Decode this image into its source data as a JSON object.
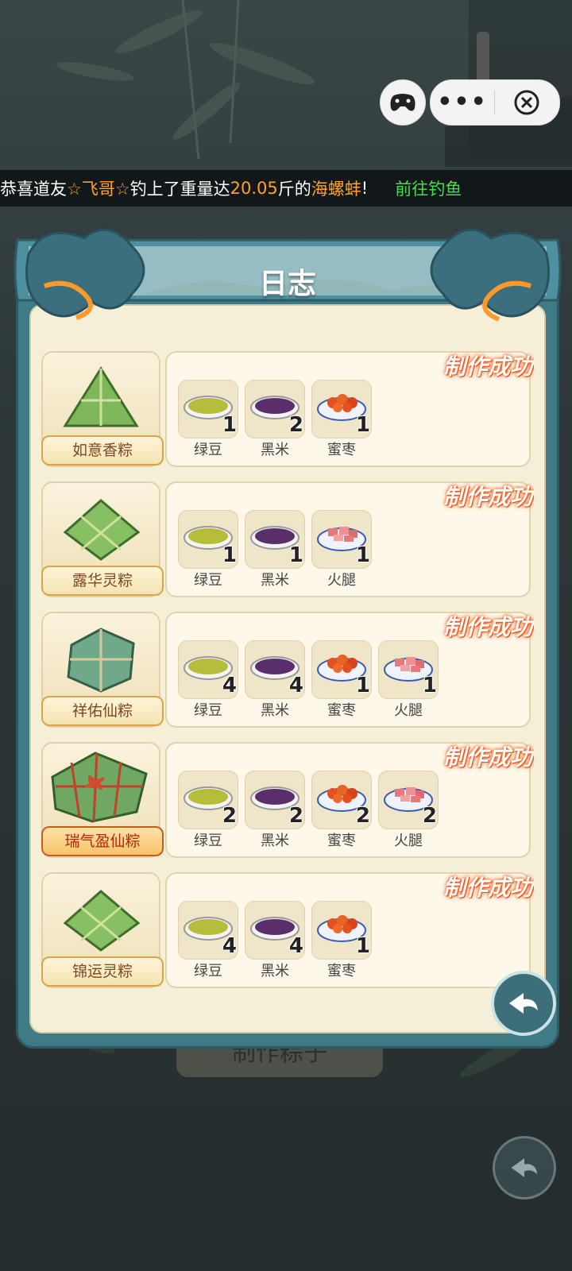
{
  "topbar": {
    "more_label": "•••"
  },
  "ticker": {
    "prefix": "恭喜道友",
    "player": "☆飞哥☆",
    "middle": "钓上了重量达",
    "weight": "20.05",
    "unit": "斤的",
    "catch": "海螺蚌",
    "suffix": "!",
    "link": "前往钓鱼"
  },
  "panel": {
    "title": "日志",
    "badge": "制作成功"
  },
  "background_button": {
    "label": "制作粽子"
  },
  "rows": [
    {
      "name": "如意香粽",
      "special": false,
      "ingredients": [
        {
          "label": "绿豆",
          "count": "1",
          "icon": "mung-bean-bowl"
        },
        {
          "label": "黑米",
          "count": "2",
          "icon": "black-rice-bowl"
        },
        {
          "label": "蜜枣",
          "count": "1",
          "icon": "candied-date-bowl"
        }
      ]
    },
    {
      "name": "露华灵粽",
      "special": false,
      "ingredients": [
        {
          "label": "绿豆",
          "count": "1",
          "icon": "mung-bean-bowl"
        },
        {
          "label": "黑米",
          "count": "1",
          "icon": "black-rice-bowl"
        },
        {
          "label": "火腿",
          "count": "1",
          "icon": "ham-bowl"
        }
      ]
    },
    {
      "name": "祥佑仙粽",
      "special": false,
      "ingredients": [
        {
          "label": "绿豆",
          "count": "4",
          "icon": "mung-bean-bowl"
        },
        {
          "label": "黑米",
          "count": "4",
          "icon": "black-rice-bowl"
        },
        {
          "label": "蜜枣",
          "count": "1",
          "icon": "candied-date-bowl"
        },
        {
          "label": "火腿",
          "count": "1",
          "icon": "ham-bowl"
        }
      ]
    },
    {
      "name": "瑞气盈仙粽",
      "special": true,
      "ingredients": [
        {
          "label": "绿豆",
          "count": "2",
          "icon": "mung-bean-bowl"
        },
        {
          "label": "黑米",
          "count": "2",
          "icon": "black-rice-bowl"
        },
        {
          "label": "蜜枣",
          "count": "2",
          "icon": "candied-date-bowl"
        },
        {
          "label": "火腿",
          "count": "2",
          "icon": "ham-bowl"
        }
      ]
    },
    {
      "name": "锦运灵粽",
      "special": false,
      "ingredients": [
        {
          "label": "绿豆",
          "count": "4",
          "icon": "mung-bean-bowl"
        },
        {
          "label": "黑米",
          "count": "4",
          "icon": "black-rice-bowl"
        },
        {
          "label": "蜜枣",
          "count": "1",
          "icon": "candied-date-bowl"
        }
      ]
    }
  ],
  "colors": {
    "panel_teal": "#3f7a87",
    "parchment": "#f6efd8",
    "accent_orange": "#ffa12a",
    "link_green": "#43e04a"
  }
}
